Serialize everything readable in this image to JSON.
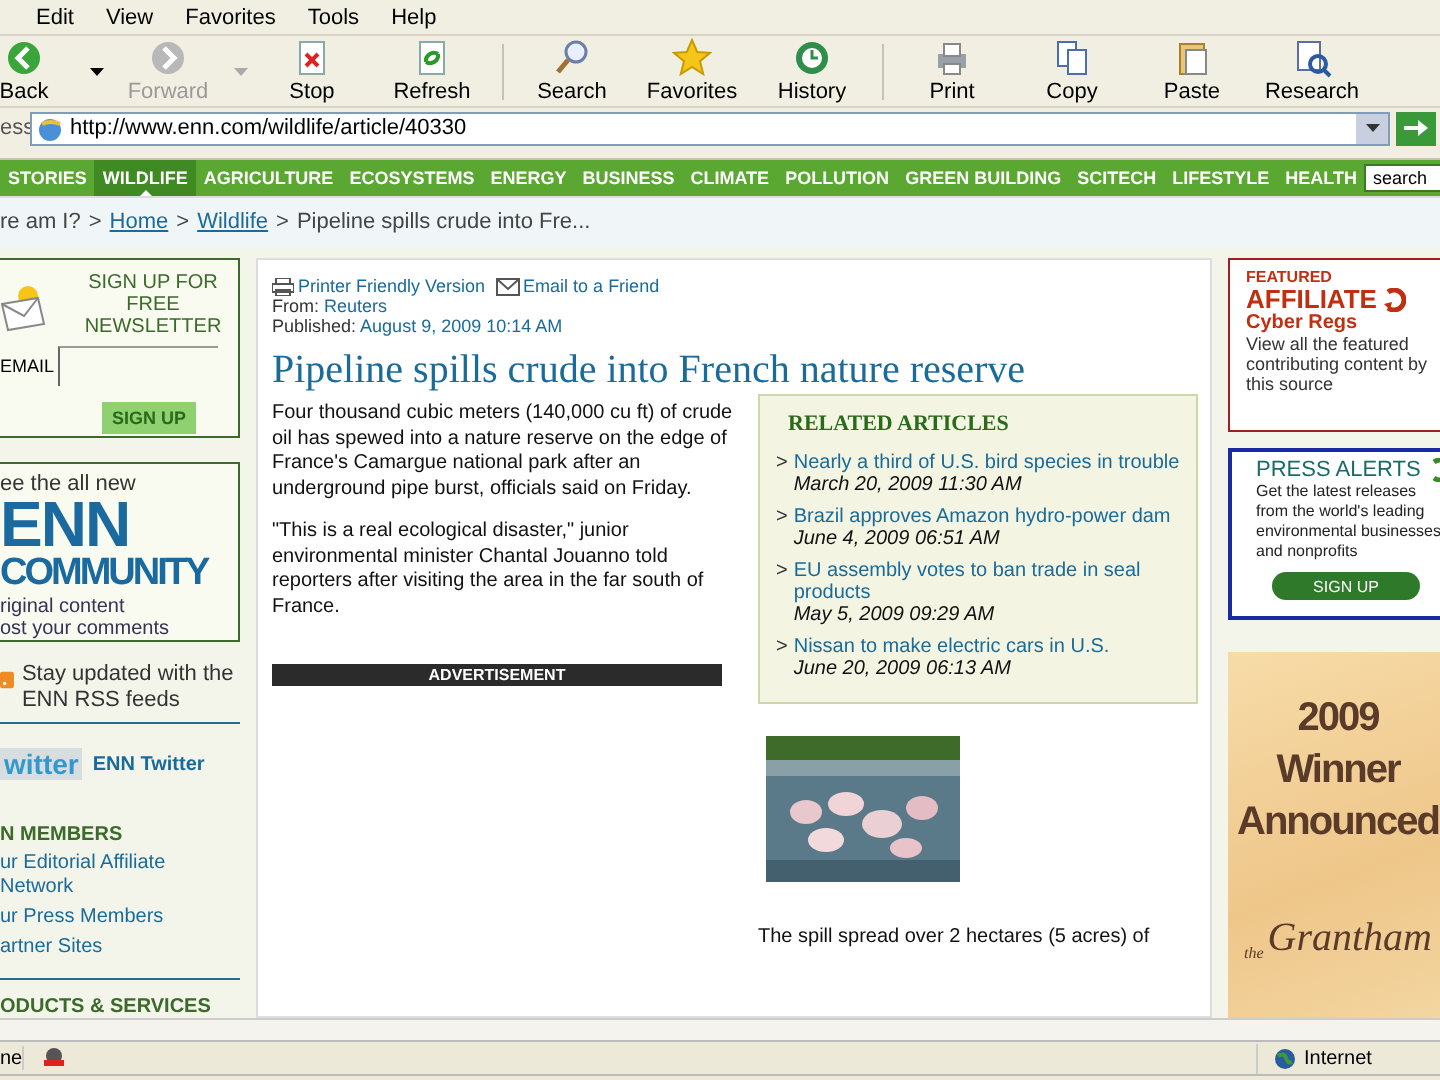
{
  "menu": [
    "Edit",
    "View",
    "Favorites",
    "Tools",
    "Help"
  ],
  "toolbar": [
    {
      "label": "Back",
      "disabled": false,
      "dropdown": true
    },
    {
      "label": "Forward",
      "disabled": true,
      "dropdown": true
    },
    {
      "label": "Stop",
      "disabled": false,
      "dropdown": false
    },
    {
      "label": "Refresh",
      "disabled": false,
      "dropdown": false
    },
    {
      "label": "Search",
      "disabled": false,
      "dropdown": false
    },
    {
      "label": "Favorites",
      "disabled": false,
      "dropdown": false
    },
    {
      "label": "History",
      "disabled": false,
      "dropdown": false
    },
    {
      "label": "Print",
      "disabled": false,
      "dropdown": false
    },
    {
      "label": "Copy",
      "disabled": false,
      "dropdown": false
    },
    {
      "label": "Paste",
      "disabled": false,
      "dropdown": false
    },
    {
      "label": "Research",
      "disabled": false,
      "dropdown": false
    }
  ],
  "address": {
    "label": "ess",
    "url": "http://www.enn.com/wildlife/article/40330"
  },
  "site_nav": {
    "tabs": [
      {
        "label": "STORIES",
        "selected": false
      },
      {
        "label": "WILDLIFE",
        "selected": true
      },
      {
        "label": "AGRICULTURE",
        "selected": false
      },
      {
        "label": "ECOSYSTEMS",
        "selected": false
      },
      {
        "label": "ENERGY",
        "selected": false
      },
      {
        "label": "BUSINESS",
        "selected": false
      },
      {
        "label": "CLIMATE",
        "selected": false
      },
      {
        "label": "POLLUTION",
        "selected": false
      },
      {
        "label": "GREEN BUILDING",
        "selected": false
      },
      {
        "label": "SCITECH",
        "selected": false
      },
      {
        "label": "LIFESTYLE",
        "selected": false
      },
      {
        "label": "HEALTH",
        "selected": false
      }
    ],
    "search": {
      "placeholder": "search"
    }
  },
  "breadcrumb": {
    "prefix": "re am I?",
    "links": [
      "Home",
      "Wildlife"
    ],
    "current": "Pipeline spills crude into Fre...",
    "separators": [
      ">",
      ">",
      ">"
    ]
  },
  "sidebar": {
    "newsletter": {
      "title": "SIGN UP FOR FREE NEWSLETTER",
      "email_label": "EMAIL",
      "button": "SIGN UP"
    },
    "community": {
      "intro": "ee the all new",
      "logo_top": "ENN",
      "logo_bottom": "COMMUNITY",
      "lines": [
        "riginal content",
        "ost your comments"
      ]
    },
    "rss": {
      "text": "Stay updated with the ENN RSS feeds"
    },
    "twitter": {
      "logo": "witter",
      "link": "ENN Twitter"
    },
    "members": {
      "heading": "N MEMBERS",
      "links": [
        "ur Editorial Affiliate Network",
        "ur Press Members",
        "artner Sites"
      ]
    },
    "products": {
      "heading": "ODUCTS & SERVICES"
    }
  },
  "article": {
    "tools": [
      "Printer Friendly Version",
      "Email to a Friend"
    ],
    "from_label": "From:",
    "source": "Reuters",
    "published_label": "Published:",
    "date": "August 9, 2009 10:14 AM",
    "headline": "Pipeline spills crude into French nature reserve",
    "paragraphs": [
      "Four thousand cubic meters (140,000 cu ft) of crude oil has spewed into a nature reserve on the edge of France's Camargue national park after an underground pipe burst, officials said on Friday.",
      "\"This is a real ecological disaster,\" junior environmental minister Chantal Jouanno told reporters after visiting the area in the far south of France."
    ],
    "advertisement": "ADVERTISEMENT",
    "related": {
      "title": "RELATED ARTICLES",
      "items": [
        {
          "marker": ">",
          "title": "Nearly a third of U.S. bird species in trouble",
          "date": "March 20, 2009 11:30 AM"
        },
        {
          "marker": ">",
          "title": "Brazil approves Amazon hydro-power dam",
          "date": "June 4, 2009 06:51 AM"
        },
        {
          "marker": ">",
          "title": "EU assembly votes to ban trade in seal products",
          "date": "May 5, 2009 09:29 AM"
        },
        {
          "marker": ">",
          "title": "Nissan to make electric cars in U.S.",
          "date": "June 20, 2009 06:13 AM"
        }
      ]
    },
    "photo": {
      "kind": "picture"
    },
    "after_photo": "The spill spread over 2 hectares (5 acres) of"
  },
  "right": {
    "featured": {
      "kicker": "FEATURED",
      "title": "AFFILIATE",
      "source": "Cyber Regs",
      "text": "View all the featured contributing content by this source"
    },
    "press_alerts": {
      "title": "PRESS ALERTS",
      "text": "Get the latest releases from the world's leading environmental businesses and nonprofits",
      "button": "SIGN UP"
    },
    "ad": {
      "year": "2009",
      "line1": "Winner",
      "line2": "Announced",
      "brand_small": "the",
      "brand": "Grantham"
    }
  },
  "status": {
    "text": "ne",
    "zone": "Internet"
  }
}
